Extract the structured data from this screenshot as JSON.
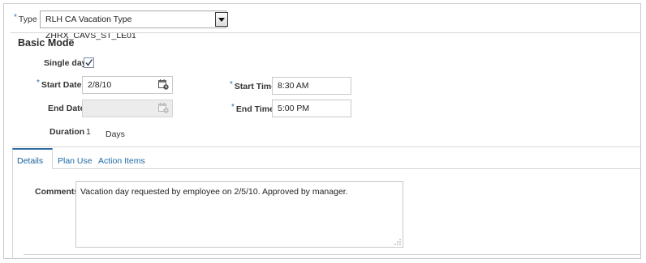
{
  "type_field": {
    "label": "Type",
    "value": "RLH CA Vacation Type ZHRX_CAVS_ST_LE01"
  },
  "basic_mode": {
    "title": "Basic Mode",
    "single_day": {
      "label": "Single day",
      "checked": true
    },
    "start_date": {
      "label": "Start Date",
      "value": "2/8/10"
    },
    "end_date": {
      "label": "End Date",
      "value": ""
    },
    "start_time": {
      "label": "Start Time",
      "value": "8:30 AM"
    },
    "end_time": {
      "label": "End Time",
      "value": "5:00 PM"
    },
    "duration": {
      "label": "Duration",
      "value": "1",
      "unit": "Days"
    }
  },
  "tabs": [
    {
      "label": "Details",
      "active": true
    },
    {
      "label": "Plan Use",
      "active": false
    },
    {
      "label": "Action Items",
      "active": false
    }
  ],
  "comments": {
    "label": "Comments",
    "value": "Vacation day requested by employee on 2/5/10.  Approved by manager."
  },
  "required_marker": "*",
  "colors": {
    "link": "#1f6aa5",
    "active_tab_underline": "#2e6da4",
    "border": "#c9c9c9"
  }
}
